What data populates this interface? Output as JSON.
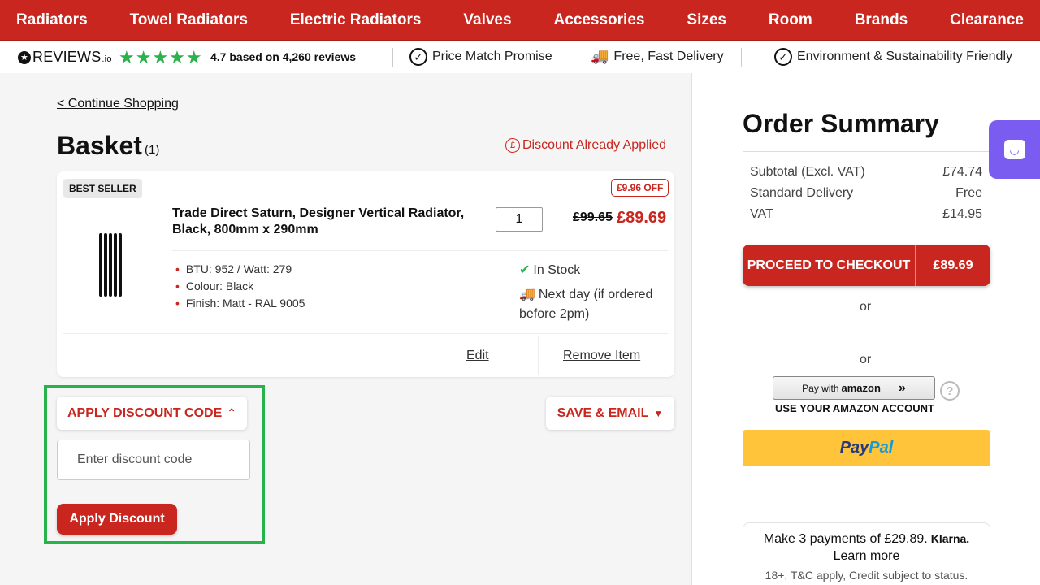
{
  "nav": {
    "items": [
      "Radiators",
      "Towel Radiators",
      "Electric Radiators",
      "Valves",
      "Accessories",
      "Sizes",
      "Room",
      "Brands",
      "Clearance"
    ]
  },
  "trust": {
    "reviews_logo": "REVIEWS",
    "reviews_logo_suffix": ".io",
    "stars": "★★★★★",
    "rating_text": "4.7 based on 4,260 reviews",
    "price_match": "Price Match Promise",
    "delivery": "Free, Fast Delivery",
    "environment": "Environment & Sustainability Friendly"
  },
  "basket": {
    "continue_link": "< Continue Shopping",
    "title": "Basket",
    "count": "(1)",
    "discount_applied": "Discount Already Applied",
    "item": {
      "badge": "BEST SELLER",
      "name": "Trade Direct Saturn, Designer Vertical Radiator, Black, 800mm x 290mm",
      "quantity": "1",
      "off_badge": "£9.96 OFF",
      "old_price": "£99.65",
      "new_price": "£89.69",
      "specs": [
        "BTU: 952  /  Watt:  279",
        "Colour: Black",
        "Finish: Matt - RAL 9005"
      ],
      "stock": "In Stock",
      "delivery": "Next day (if ordered before 2pm)",
      "edit": "Edit",
      "remove": "Remove Item"
    },
    "discount": {
      "toggle_label": "APPLY DISCOUNT CODE",
      "input_placeholder": "Enter discount code",
      "apply_button": "Apply Discount"
    },
    "save_email": "SAVE & EMAIL"
  },
  "summary": {
    "title": "Order Summary",
    "rows": [
      {
        "label": "Subtotal (Excl. VAT)",
        "value": "£74.74"
      },
      {
        "label": "Standard Delivery",
        "value": "Free"
      },
      {
        "label": "VAT",
        "value": "£14.95"
      }
    ],
    "checkout_label": "PROCEED TO CHECKOUT",
    "checkout_amount": "£89.69",
    "or": "or",
    "amazon_pay_with": "Pay with",
    "amazon_brand": "amazon",
    "amazon_note": "USE YOUR AMAZON ACCOUNT",
    "paypal_1": "Pay",
    "paypal_2": "Pal",
    "klarna_text": "Make 3 payments of £29.89.",
    "klarna_brand": "Klarna.",
    "learn_more": "Learn more",
    "klarna_small": "18+, T&C apply, Credit subject to status."
  },
  "colors": {
    "brand_red": "#c8261e",
    "highlight_green": "#27b24a",
    "paypal_yellow": "#ffc439",
    "chat_purple": "#7b5cf0"
  }
}
